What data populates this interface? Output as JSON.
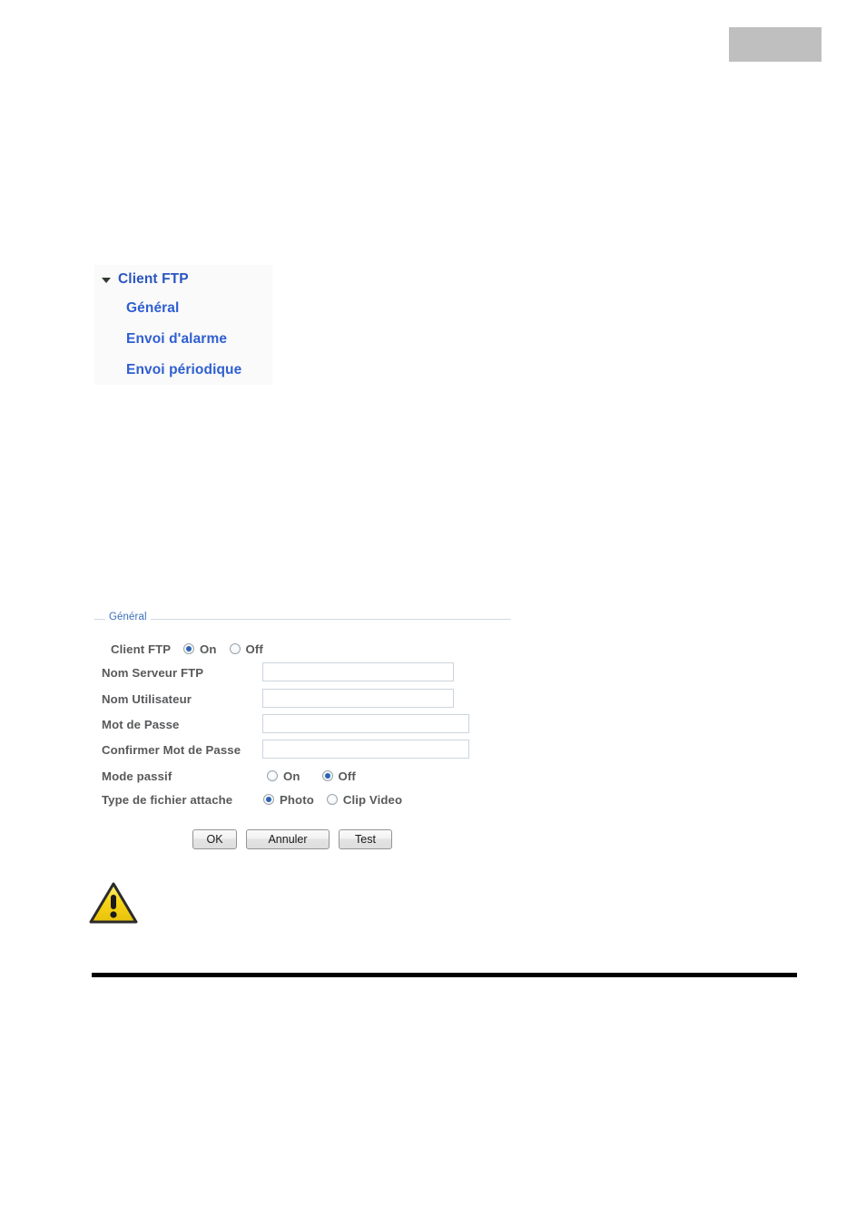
{
  "page": {
    "header_block": {
      "name": "header-tab-block",
      "color": "#bfbfbf",
      "label": ""
    }
  },
  "nav": {
    "root": {
      "label": "Client FTP",
      "icon": "chevron-down-icon",
      "expanded": true
    },
    "items": [
      {
        "label": "Général"
      },
      {
        "label": "Envoi d'alarme"
      },
      {
        "label": "Envoi périodique"
      }
    ],
    "link_color": "#2f5fd0",
    "panel_color": "#fafafa"
  },
  "form": {
    "legend": "Général",
    "legend_color": "#3a6fb8",
    "rows": {
      "client_ftp": {
        "label": "Client FTP",
        "options": [
          {
            "label": "On",
            "selected": true
          },
          {
            "label": "Off",
            "selected": false
          }
        ]
      },
      "server_name": {
        "label": "Nom Serveur FTP",
        "value": "",
        "placeholder": ""
      },
      "user_name": {
        "label": "Nom Utilisateur",
        "value": "",
        "placeholder": ""
      },
      "password": {
        "label": "Mot de Passe",
        "value": "",
        "placeholder": ""
      },
      "confirm_password": {
        "label": "Confirmer Mot de Passe",
        "value": "",
        "placeholder": ""
      },
      "passive_mode": {
        "label": "Mode passif",
        "options": [
          {
            "label": "On",
            "selected": false
          },
          {
            "label": "Off",
            "selected": true
          }
        ]
      },
      "file_type": {
        "label": "Type de fichier attache",
        "options": [
          {
            "label": "Photo",
            "selected": true
          },
          {
            "label": "Clip Video",
            "selected": false
          }
        ]
      }
    },
    "buttons": {
      "ok": "OK",
      "cancel": "Annuler",
      "test": "Test"
    }
  },
  "notice": {
    "icon": "warning-triangle-icon",
    "icon_color": "#f5d300",
    "text": ""
  }
}
